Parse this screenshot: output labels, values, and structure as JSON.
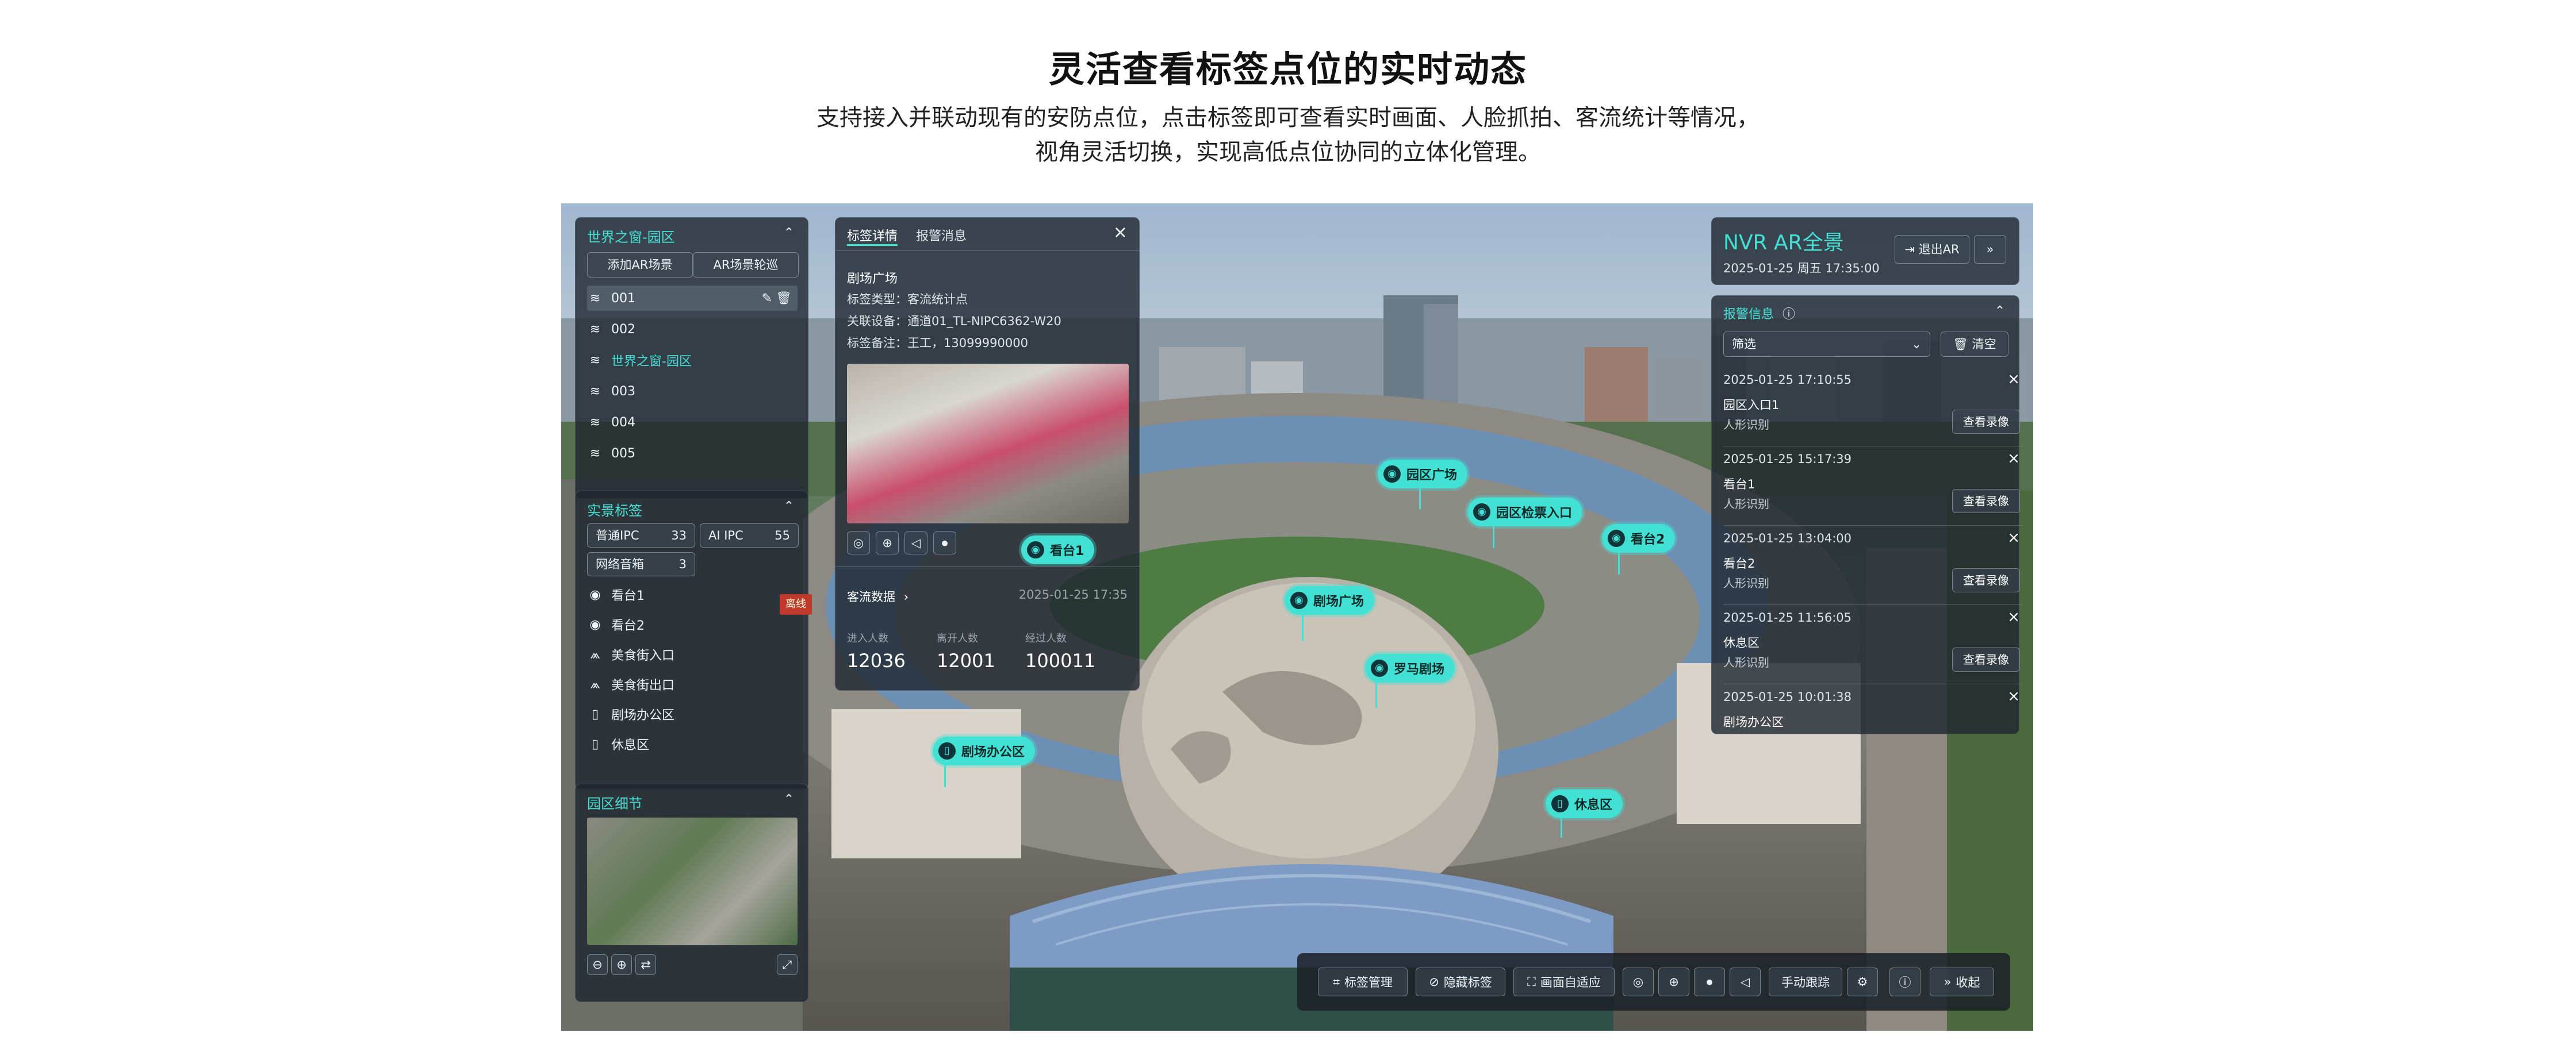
{
  "header": {
    "title": "灵活查看标签点位的实时动态",
    "subtitle_line1": "支持接入并联动现有的安防点位，点击标签即可查看实时画面、人脸抓拍、客流统计等情况，",
    "subtitle_line2": "视角灵活切换，实现高低点位协同的立体化管理。"
  },
  "left_panel": {
    "title": "世界之窗-园区",
    "add_scene_label": "添加AR场景",
    "tour_label": "AR场景轮巡",
    "scenes": [
      {
        "label": "001",
        "active": false
      },
      {
        "label": "002",
        "active": false
      },
      {
        "label": "世界之窗-园区",
        "active": true
      },
      {
        "label": "003",
        "active": false
      },
      {
        "label": "004",
        "active": false
      },
      {
        "label": "005",
        "active": false
      }
    ]
  },
  "tags_panel": {
    "title": "实景标签",
    "stats": [
      {
        "label": "普通IPC",
        "value": "33"
      },
      {
        "label": "AI IPC",
        "value": "55"
      },
      {
        "label": "网络音箱",
        "value": "3"
      }
    ],
    "items": [
      {
        "label": "看台1",
        "icon": "location-pin-icon"
      },
      {
        "label": "看台2",
        "icon": "location-pin-icon"
      },
      {
        "label": "美食街入口",
        "icon": "person-count-icon"
      },
      {
        "label": "美食街出口",
        "icon": "person-count-icon"
      },
      {
        "label": "剧场办公区",
        "icon": "speaker-icon"
      },
      {
        "label": "休息区",
        "icon": "speaker-icon"
      }
    ]
  },
  "detail_panel": {
    "title": "园区细节"
  },
  "tag_detail": {
    "tab_detail": "标签详情",
    "tab_alarm": "报警消息",
    "name": "剧场广场",
    "type_line": "标签类型：客流统计点",
    "device_line": "关联设备：通道01_TL-NIPC6362-W20",
    "note_line": "标签备注：王工，13099990000",
    "flow_title": "客流数据",
    "flow_time": "2025-01-25 17:35",
    "metrics": [
      {
        "label": "进入人数",
        "value": "12036"
      },
      {
        "label": "离开人数",
        "value": "12001"
      },
      {
        "label": "经过人数",
        "value": "100011"
      }
    ]
  },
  "nvr_panel": {
    "title": "NVR AR全景",
    "datetime": "2025-01-25 周五 17:35:00",
    "exit_label": "退出AR"
  },
  "alarm_panel": {
    "title": "报警信息",
    "filter_label": "筛选",
    "clear_label": "清空",
    "view_label": "查看录像",
    "items": [
      {
        "time": "2025-01-25 17:10:55",
        "name": "园区入口1",
        "kind": "人形识别"
      },
      {
        "time": "2025-01-25 15:17:39",
        "name": "看台1",
        "kind": "人形识别"
      },
      {
        "time": "2025-01-25 13:04:00",
        "name": "看台2",
        "kind": "人形识别"
      },
      {
        "time": "2025-01-25 11:56:05",
        "name": "休息区",
        "kind": "人形识别"
      },
      {
        "time": "2025-01-25 10:01:38",
        "name": "剧场办公区",
        "kind": ""
      }
    ]
  },
  "markers": {
    "yuanqu_guangchang": "园区广场",
    "yuanqu_jianpiao": "园区检票入口",
    "kantai2": "看台2",
    "kantai1": "看台1",
    "juchang_guangchang": "剧场广场",
    "luoma_juchang": "罗马剧场",
    "juchang_bangong": "剧场办公区",
    "xiuxi": "休息区"
  },
  "toolbar": {
    "tag_manage": "标签管理",
    "hide_tags": "隐藏标签",
    "fit_screen": "画面自适应",
    "manual_track": "手动跟踪",
    "collapse": "收起"
  },
  "scene_text": {
    "shop_sign": "离线"
  },
  "colors": {
    "accent": "#43e0d4",
    "panel_bg": "#1e262e",
    "roof_blue": "#7d9bc4"
  }
}
